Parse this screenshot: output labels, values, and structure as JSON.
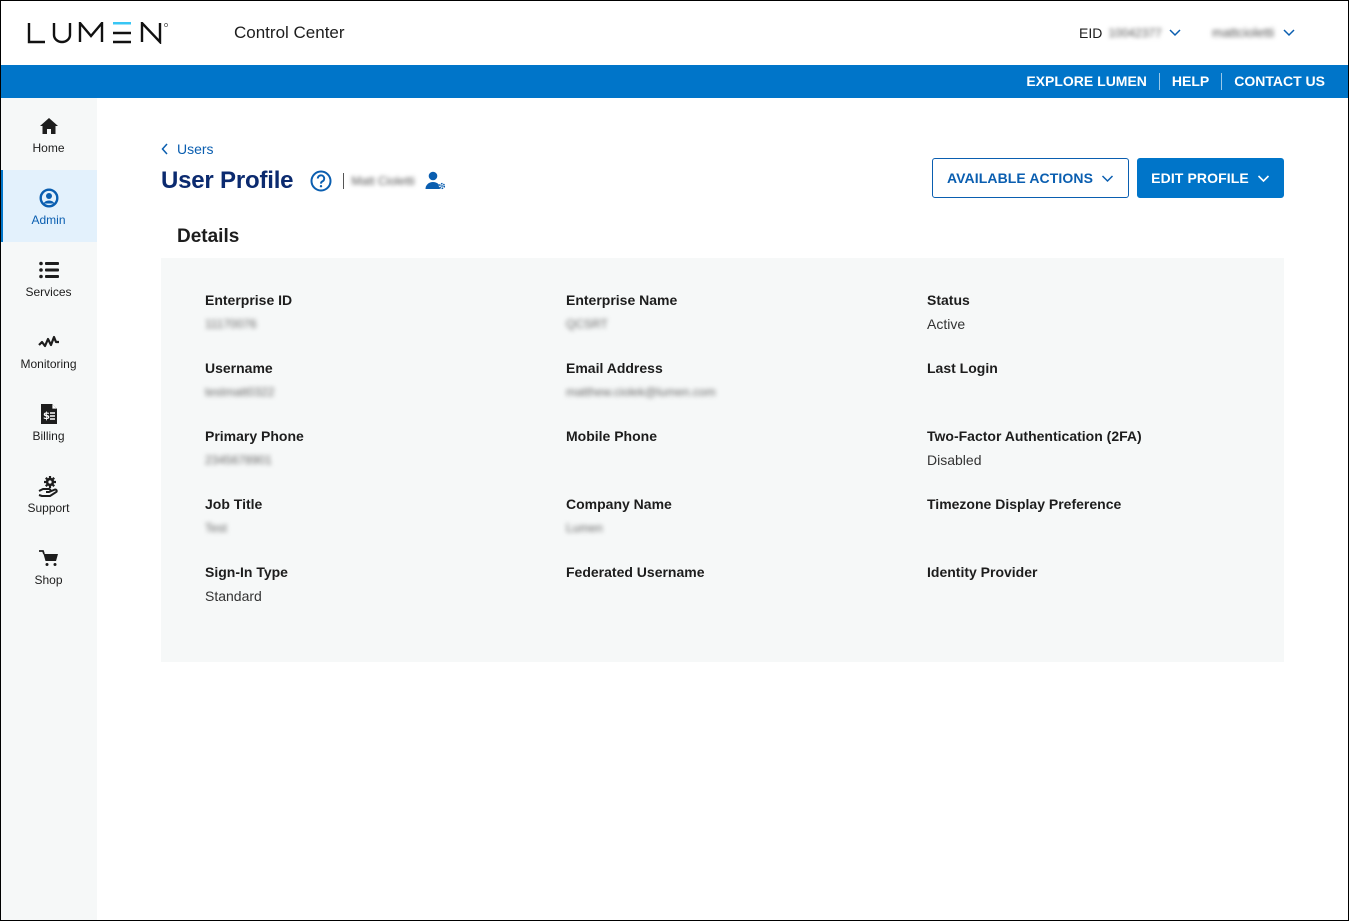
{
  "header": {
    "brand": "LUMEN",
    "app_title": "Control Center",
    "eid_label": "EID",
    "eid_value": "10042377",
    "user_menu": "mattcioletti"
  },
  "utility_nav": {
    "links": [
      {
        "label": "EXPLORE LUMEN"
      },
      {
        "label": "HELP"
      },
      {
        "label": "CONTACT US"
      }
    ]
  },
  "colors": {
    "brand_blue": "#0075c9",
    "title_navy": "#0b2a6f",
    "active_nav_bg": "#e3f1fc",
    "card_bg": "#f6f8f8",
    "logo_accent": "#38c6f4"
  },
  "sidebar": {
    "items": [
      {
        "label": "Home",
        "icon": "home-icon",
        "active": false
      },
      {
        "label": "Admin",
        "icon": "user-circle-icon",
        "active": true
      },
      {
        "label": "Services",
        "icon": "list-icon",
        "active": false
      },
      {
        "label": "Monitoring",
        "icon": "pulse-icon",
        "active": false
      },
      {
        "label": "Billing",
        "icon": "invoice-icon",
        "active": false
      },
      {
        "label": "Support",
        "icon": "support-gear-hand-icon",
        "active": false
      },
      {
        "label": "Shop",
        "icon": "cart-icon",
        "active": false
      }
    ]
  },
  "page": {
    "breadcrumb": "Users",
    "title": "User Profile",
    "user_display_name": "Matt Cioletti",
    "actions": {
      "available_actions": "AVAILABLE ACTIONS",
      "edit_profile": "EDIT PROFILE"
    },
    "section_title": "Details",
    "fields": [
      {
        "label": "Enterprise ID",
        "value": "11170076",
        "blurred": true
      },
      {
        "label": "Enterprise Name",
        "value": "QCSRT",
        "blurred": true
      },
      {
        "label": "Status",
        "value": "Active",
        "blurred": false
      },
      {
        "label": "Username",
        "value": "testmatt0322",
        "blurred": true
      },
      {
        "label": "Email Address",
        "value": "matthew.ciolek@lumen.com",
        "blurred": true
      },
      {
        "label": "Last Login",
        "value": "",
        "blurred": false
      },
      {
        "label": "Primary Phone",
        "value": "2345678901",
        "blurred": true
      },
      {
        "label": "Mobile Phone",
        "value": "",
        "blurred": false
      },
      {
        "label": "Two-Factor Authentication (2FA)",
        "value": "Disabled",
        "blurred": false
      },
      {
        "label": "Job Title",
        "value": "Test",
        "blurred": true
      },
      {
        "label": "Company Name",
        "value": "Lumen",
        "blurred": true
      },
      {
        "label": "Timezone Display Preference",
        "value": "",
        "blurred": false
      },
      {
        "label": "Sign-In Type",
        "value": "Standard",
        "blurred": false
      },
      {
        "label": "Federated Username",
        "value": "",
        "blurred": false
      },
      {
        "label": "Identity Provider",
        "value": "",
        "blurred": false
      }
    ]
  }
}
